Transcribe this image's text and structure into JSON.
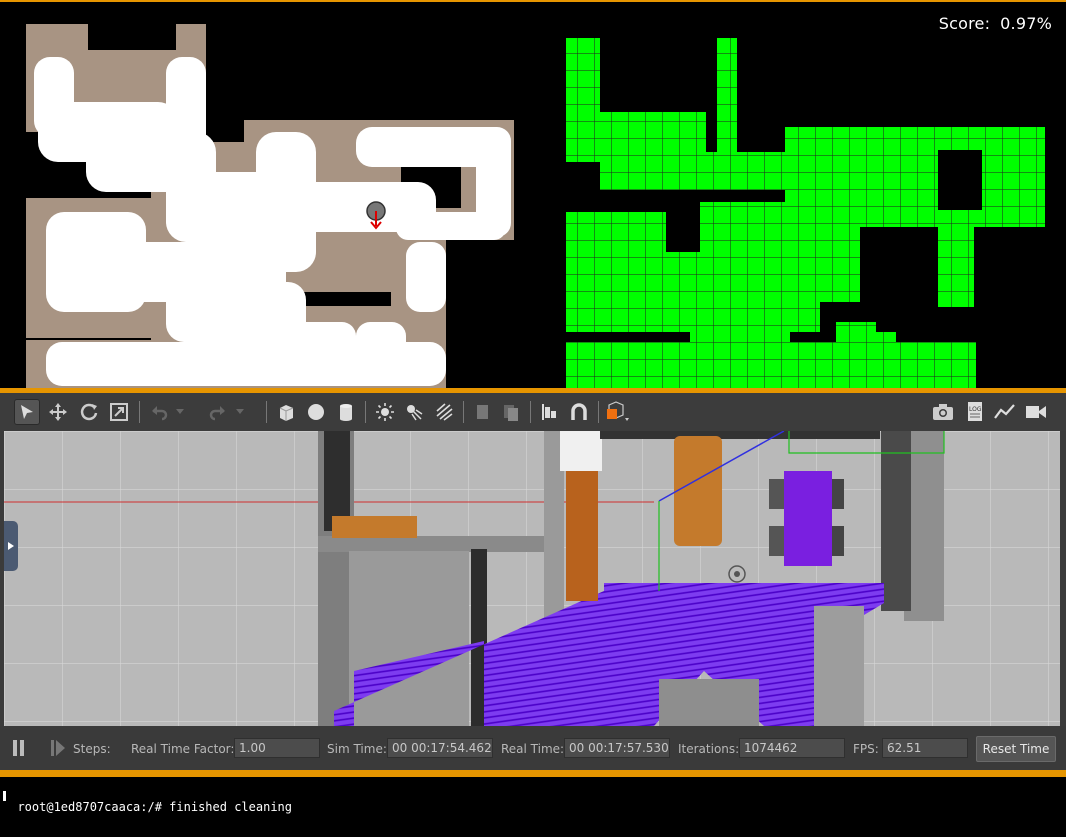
{
  "score": {
    "label": "Score:",
    "value": "0.97%"
  },
  "colors": {
    "accent": "#e69500",
    "coverage_green": "#00ff00",
    "floor_tan": "#a89483",
    "cleaned_white": "#ffffff",
    "laser_purple": "#6a1fe0"
  },
  "toolbar": {
    "tools": [
      "select-arrow-icon",
      "translate-icon",
      "rotate-icon",
      "scale-icon",
      "undo-icon",
      "redo-icon",
      "box-icon",
      "sphere-icon",
      "cylinder-icon",
      "point-light-icon",
      "spot-light-icon",
      "directional-light-icon",
      "copy-icon",
      "paste-icon",
      "align-icon",
      "snap-icon",
      "view-angle-icon",
      "screenshot-icon",
      "log-icon",
      "plot-icon",
      "video-icon"
    ]
  },
  "status": {
    "steps_label": "Steps:",
    "rtf_label": "Real Time Factor:",
    "rtf_value": "1.00",
    "sim_time_label": "Sim Time:",
    "sim_time_value": "00 00:17:54.462",
    "real_time_label": "Real Time:",
    "real_time_value": "00 00:17:57.530",
    "iterations_label": "Iterations:",
    "iterations_value": "1074462",
    "fps_label": "FPS:",
    "fps_value": "62.51",
    "reset_label": "Reset Time"
  },
  "terminal": {
    "line": "root@1ed8707caaca:/# finished cleaning"
  }
}
